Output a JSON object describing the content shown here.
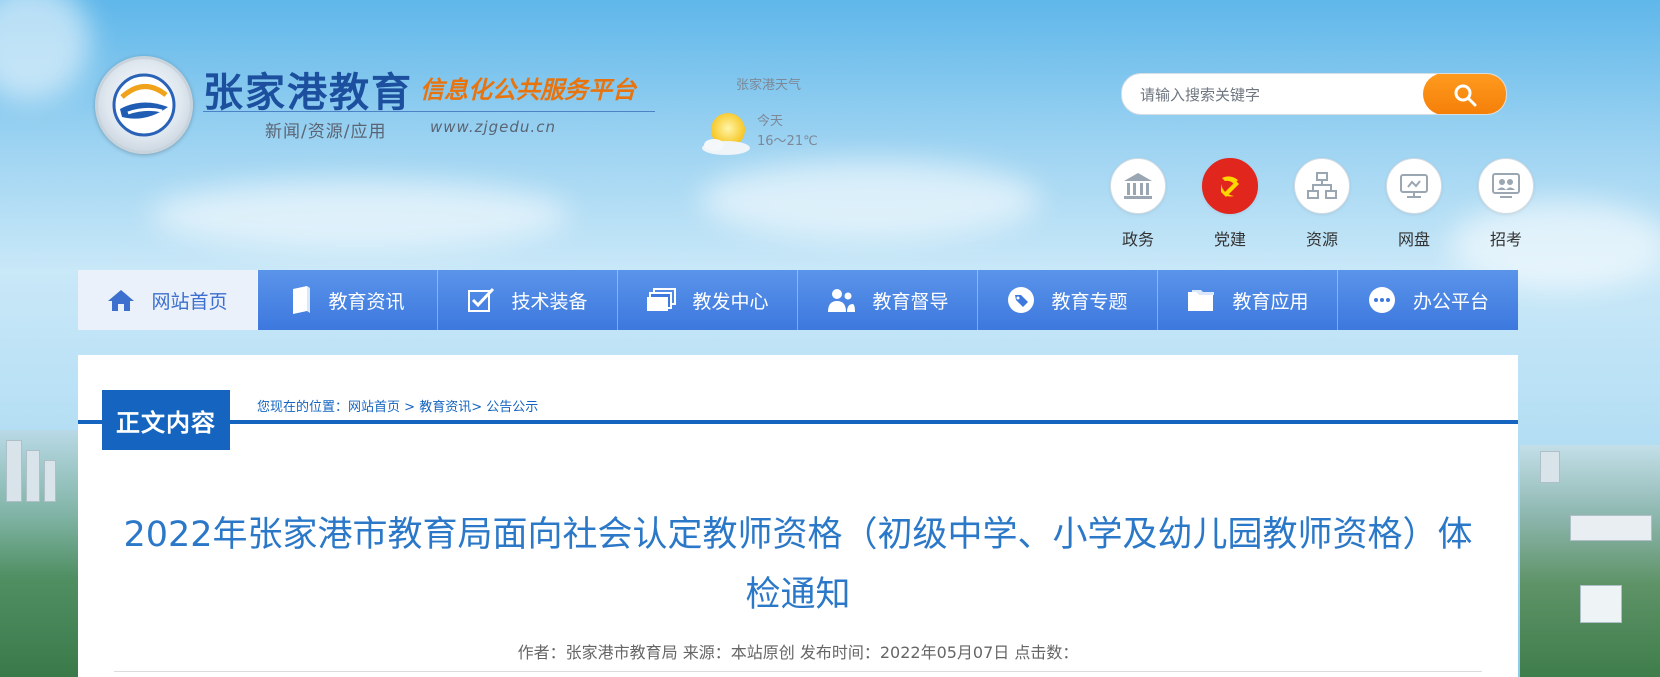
{
  "header": {
    "site_name": "张家港教育",
    "site_subtitle": "信息化公共服务平台",
    "tagline": "新闻/资源/应用",
    "url": "www.zjgedu.cn"
  },
  "weather": {
    "title": "张家港天气",
    "day": "今天",
    "temperature": "16～21℃",
    "icon": "sun-cloud-icon"
  },
  "search": {
    "placeholder": "请输入搜索关键字",
    "value": ""
  },
  "quick_links": [
    {
      "label": "政务",
      "icon": "government-building-icon"
    },
    {
      "label": "党建",
      "icon": "party-emblem-icon"
    },
    {
      "label": "资源",
      "icon": "resource-tree-icon"
    },
    {
      "label": "网盘",
      "icon": "cloud-disk-icon"
    },
    {
      "label": "招考",
      "icon": "exam-icon"
    }
  ],
  "nav": [
    {
      "label": "网站首页",
      "icon": "home-icon",
      "active": true
    },
    {
      "label": "教育资讯",
      "icon": "book-icon"
    },
    {
      "label": "技术装备",
      "icon": "checkbox-icon"
    },
    {
      "label": "教发中心",
      "icon": "layers-icon"
    },
    {
      "label": "教育督导",
      "icon": "users-icon"
    },
    {
      "label": "教育专题",
      "icon": "tag-icon"
    },
    {
      "label": "教育应用",
      "icon": "folder-icon"
    },
    {
      "label": "办公平台",
      "icon": "chat-icon"
    }
  ],
  "section": {
    "title": "正文内容",
    "breadcrumb_prefix": "您现在的位置：",
    "breadcrumb": [
      "网站首页",
      "教育资讯",
      "公告公示"
    ],
    "separator_1": " > ",
    "separator_2": "> "
  },
  "article": {
    "title": "2022年张家港市教育局面向社会认定教师资格（初级中学、小学及幼儿园教师资格）体检通知",
    "author_label": "作者：",
    "author": "张家港市教育局",
    "source_label": "来源：",
    "source": "本站原创",
    "date_label": "发布时间：",
    "date": "2022年05月07日",
    "clicks_label": "点击数："
  },
  "colors": {
    "nav_blue": "#3d78de",
    "section_blue": "#1565c0",
    "title_blue": "#2b78c8",
    "search_orange": "#f57f08",
    "party_red": "#e0261d"
  }
}
